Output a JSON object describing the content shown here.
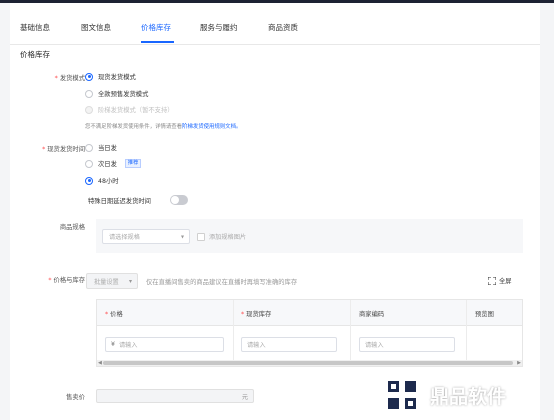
{
  "tabs": [
    {
      "label": "基础信息"
    },
    {
      "label": "图文信息"
    },
    {
      "label": "价格库存"
    },
    {
      "label": "服务与履约"
    },
    {
      "label": "商品资质"
    }
  ],
  "section_title": "价格库存",
  "shipping_mode": {
    "label": "发货模式",
    "options": [
      {
        "label": "现货发货模式",
        "selected": true
      },
      {
        "label": "全款预售发货模式",
        "selected": false
      },
      {
        "label": "阶梯发货模式（暂不支持）",
        "selected": false,
        "disabled": true
      }
    ],
    "hint_prefix": "您不满足阶梯发货使用条件，详情请查看",
    "hint_link": "阶梯发货使用规则文档。"
  },
  "ship_time": {
    "label": "现货发货时间",
    "options": [
      {
        "label": "当日发",
        "selected": false
      },
      {
        "label": "次日发",
        "selected": false,
        "tag": "推荐"
      },
      {
        "label": "48小时",
        "selected": true
      }
    ],
    "delay_label": "特殊日期延迟发货时间",
    "delay_enabled": false
  },
  "spec": {
    "label": "商品规格",
    "select_placeholder": "请选择规格",
    "add_image_label": "添加规格图片"
  },
  "price_stock": {
    "label": "价格与库存",
    "batch_button": "批量设置",
    "batch_hint": "仅在直播间售卖的商品建议在直播时再填写准确的库存",
    "fullscreen_label": "全屏",
    "columns": [
      {
        "label": "价格",
        "required": true
      },
      {
        "label": "现货库存",
        "required": true
      },
      {
        "label": "商家编码",
        "required": false
      },
      {
        "label": "预览图",
        "required": false
      }
    ],
    "row": {
      "price_prefix": "¥",
      "price_placeholder": "请输入",
      "stock_placeholder": "请输入",
      "code_placeholder": "请输入"
    }
  },
  "sale_price": {
    "label": "售卖价",
    "unit": "元"
  },
  "watermark": {
    "text": "鼎品软件"
  },
  "colors": {
    "accent": "#1966ff",
    "required": "#ff4d4f"
  }
}
